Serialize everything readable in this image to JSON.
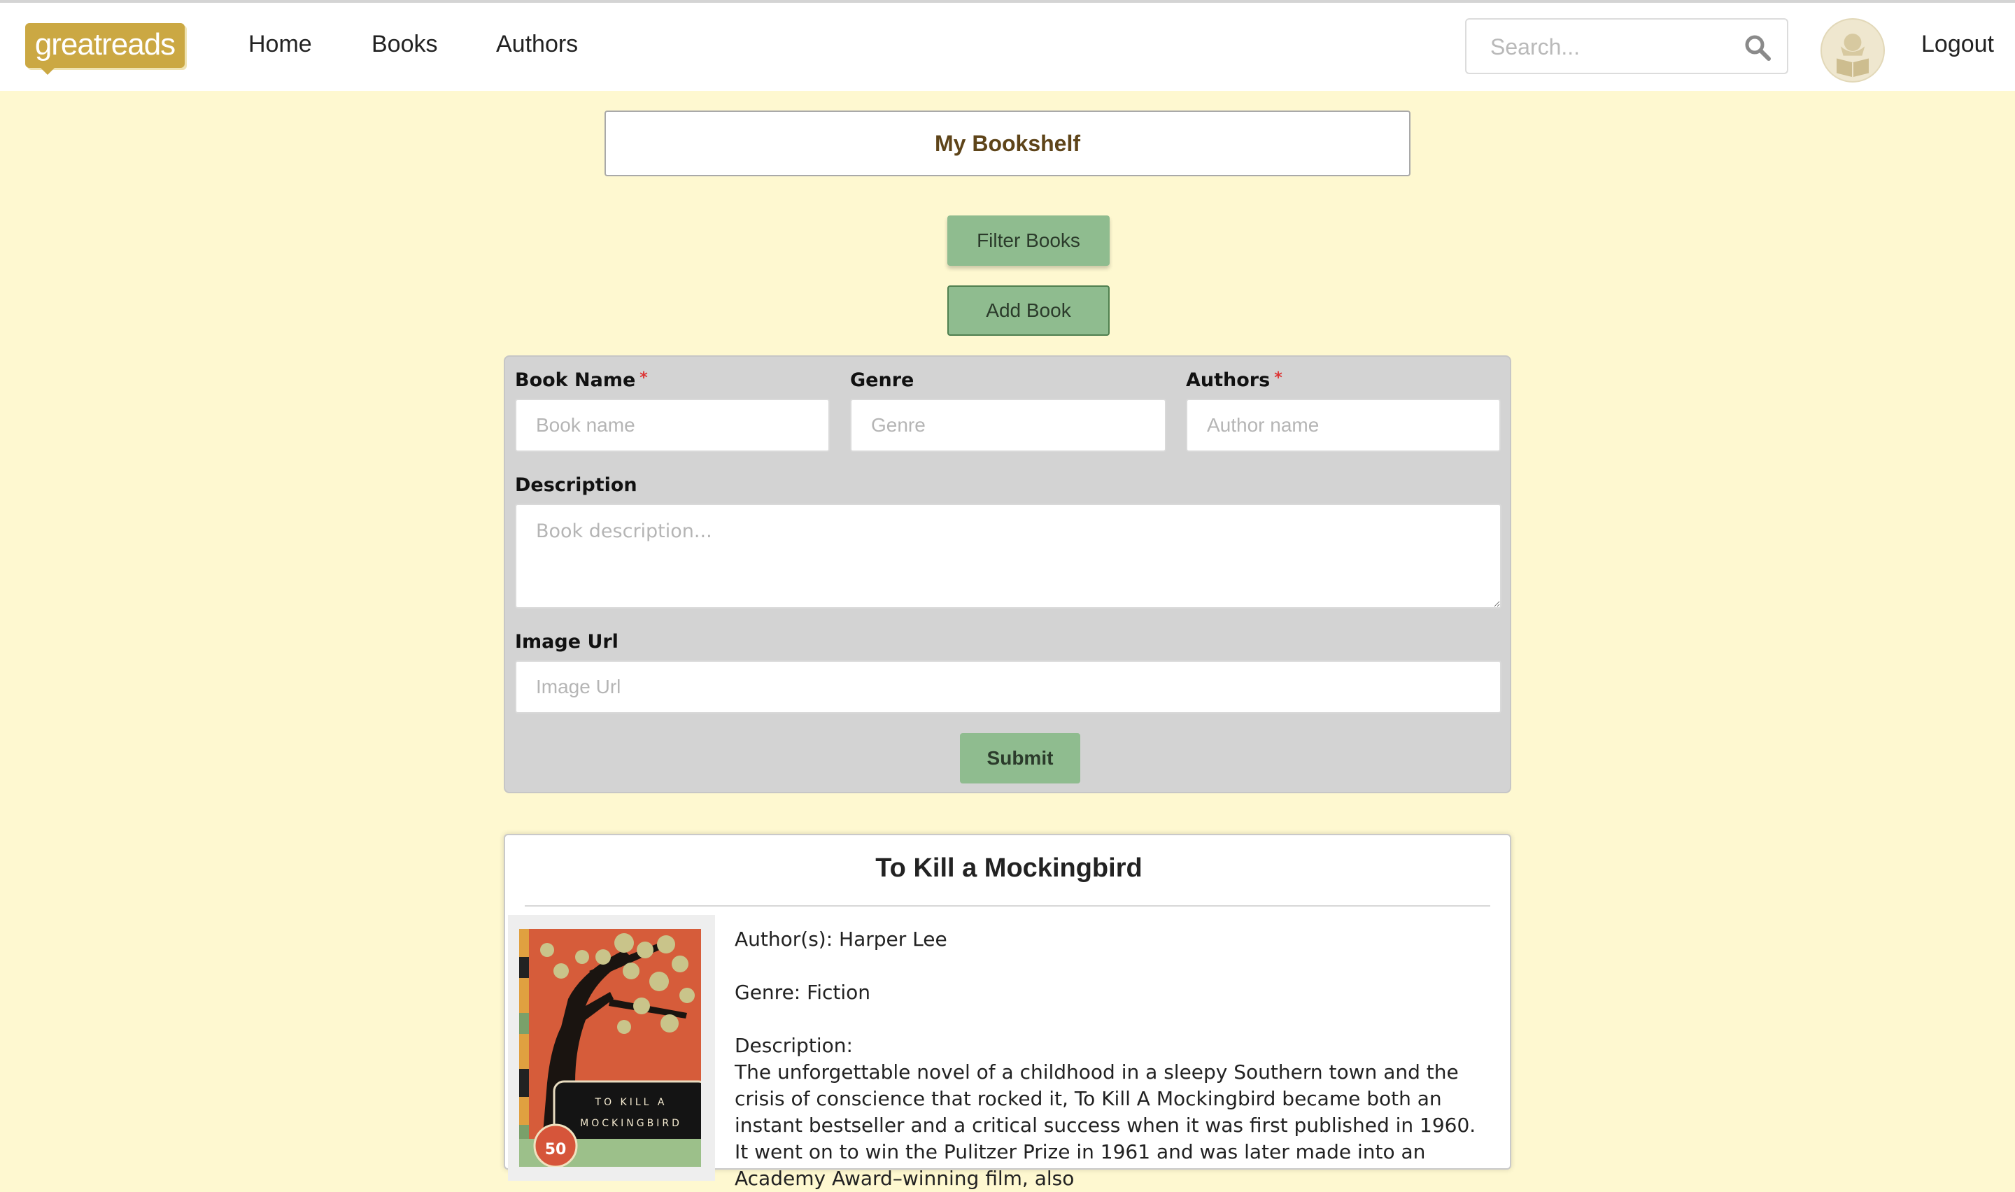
{
  "navbar": {
    "logo": "greatreads",
    "links": [
      "Home",
      "Books",
      "Authors"
    ],
    "search_placeholder": "Search...",
    "logout": "Logout"
  },
  "shelf": {
    "title": "My Bookshelf",
    "filter_label": "Filter Books",
    "add_label": "Add Book"
  },
  "form": {
    "book_name": {
      "label": "Book Name",
      "required_mark": "*",
      "placeholder": "Book name"
    },
    "genre": {
      "label": "Genre",
      "placeholder": "Genre"
    },
    "authors": {
      "label": "Authors",
      "required_mark": "*",
      "placeholder": "Author name"
    },
    "description": {
      "label": "Description",
      "placeholder": "Book description..."
    },
    "image_url": {
      "label": "Image Url",
      "placeholder": "Image Url"
    },
    "submit_label": "Submit"
  },
  "book": {
    "title": "To Kill a Mockingbird",
    "authors_line": "Author(s): Harper Lee",
    "genre_line": "Genre: Fiction",
    "description_label": "Description:",
    "description": "The unforgettable novel of a childhood in a sleepy Southern town and the crisis of conscience that rocked it, To Kill A Mockingbird became both an instant bestseller and a critical success when it was first published in 1960. It went on to win the Pulitzer Prize in 1961 and was later made into an Academy Award–winning film, also",
    "cover_text_line1": "TO KILL A",
    "cover_text_line2": "MOCKINGBIRD",
    "cover_badge": "50"
  },
  "colors": {
    "page_background": "#fef8d0",
    "logo": "#cba843",
    "button_green": "#8fbc8f",
    "form_panel": "#d3d3d3",
    "heading_brown": "#5e4419"
  },
  "icons": {
    "search": "search-icon",
    "avatar": "reader-avatar-icon"
  }
}
